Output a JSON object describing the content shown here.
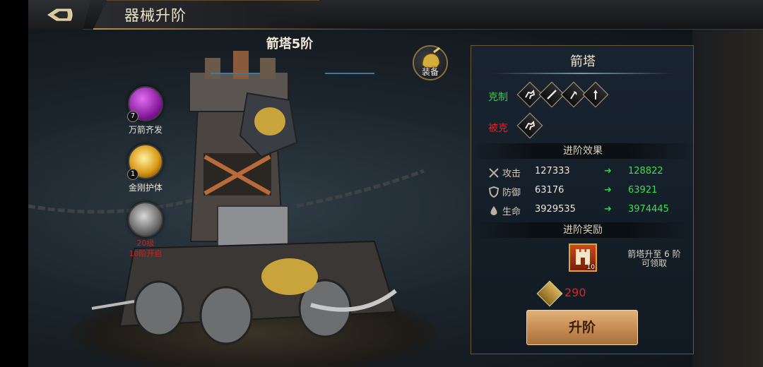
{
  "header": {
    "title": "器械升阶"
  },
  "scene": {
    "tower_title": "箭塔5阶",
    "skills": [
      {
        "name": "万箭齐发",
        "level": "7",
        "color": "#b02cc8"
      },
      {
        "name": "金刚护体",
        "level": "1",
        "color": "#e0a020"
      },
      {
        "name": "",
        "lock_line1": "20级",
        "lock_line2": "10阶开启",
        "color": "#8a8a8a"
      }
    ],
    "equip_label": "装备"
  },
  "panel": {
    "title": "箭塔",
    "counters_label": "克制",
    "countered_by_label": "被克",
    "counters_icons": [
      "cavalry-icon",
      "sword-icon",
      "axe-icon",
      "spear-icon"
    ],
    "countered_by_icons": [
      "cavalry-icon"
    ],
    "effect_header": "进阶效果",
    "stats": [
      {
        "icon": "crossed-swords-icon",
        "name": "攻击",
        "current": "127333",
        "next": "128822"
      },
      {
        "icon": "shield-icon",
        "name": "防御",
        "current": "63176",
        "next": "63921"
      },
      {
        "icon": "drop-icon",
        "name": "生命",
        "current": "3929535",
        "next": "3974445"
      }
    ],
    "reward_header": "进阶奖励",
    "reward": {
      "count": "10",
      "desc_line1": "箭塔升至 6 阶",
      "desc_line2": "可领取"
    },
    "cost_value": "290",
    "upgrade_label": "升阶"
  },
  "colors": {
    "accent_gold": "#b78f45",
    "counter_green": "#2fc94a",
    "countered_red": "#e0202a"
  }
}
